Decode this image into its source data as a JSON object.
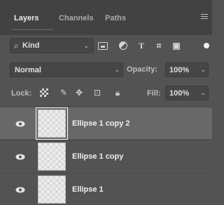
{
  "tabs": [
    {
      "label": "Layers",
      "active": true
    },
    {
      "label": "Channels",
      "active": false
    },
    {
      "label": "Paths",
      "active": false
    }
  ],
  "filter": {
    "kind_label": "Kind",
    "icons": [
      "image-filter-icon",
      "adjustment-filter-icon",
      "type-filter-icon",
      "shape-filter-icon",
      "smart-object-filter-icon",
      "filter-toggle-icon"
    ]
  },
  "blend": {
    "mode": "Normal",
    "opacity_label": "Opacity:",
    "opacity_value": "100%"
  },
  "lock": {
    "label": "Lock:",
    "fill_label": "Fill:",
    "fill_value": "100%"
  },
  "layers": [
    {
      "name": "Ellipse 1 copy 2",
      "visible": true,
      "selected": true
    },
    {
      "name": "Ellipse 1 copy",
      "visible": true,
      "selected": false
    },
    {
      "name": "Ellipse 1",
      "visible": true,
      "selected": false
    }
  ]
}
